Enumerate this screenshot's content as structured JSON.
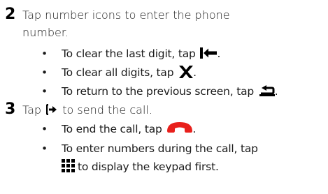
{
  "steps": [
    {
      "number": "2",
      "text_line1": "Tap number icons to enter the phone",
      "text_line2": "number.",
      "bullets": [
        {
          "bullet": "•",
          "text": "To clear the last digit, tap",
          "icon": "backspace-arrow-icon",
          "end": "."
        },
        {
          "bullet": "•",
          "text": "To clear all digits, tap",
          "icon": "x-icon",
          "end": "."
        },
        {
          "bullet": "•",
          "text": "To return to the previous screen, tap",
          "icon": "return-arrow-icon",
          "end": "."
        }
      ]
    },
    {
      "number": "3",
      "text_pre": "Tap",
      "text_icon": "send-call-arrow-icon",
      "text_post": "to send the call.",
      "bullets": [
        {
          "bullet": "•",
          "text": "To end the call, tap",
          "icon": "end-call-handset-icon",
          "end": "."
        },
        {
          "bullet": "•",
          "text": "To enter numbers during the call, tap",
          "icon": null,
          "end": ""
        },
        {
          "bullet": "",
          "text": "to display the keypad first.",
          "icon": "keypad-grid-icon",
          "end": ""
        }
      ]
    }
  ],
  "colors": {
    "text": "#1a1a1a",
    "icon": "#000000",
    "end_call": "#e8201c"
  }
}
